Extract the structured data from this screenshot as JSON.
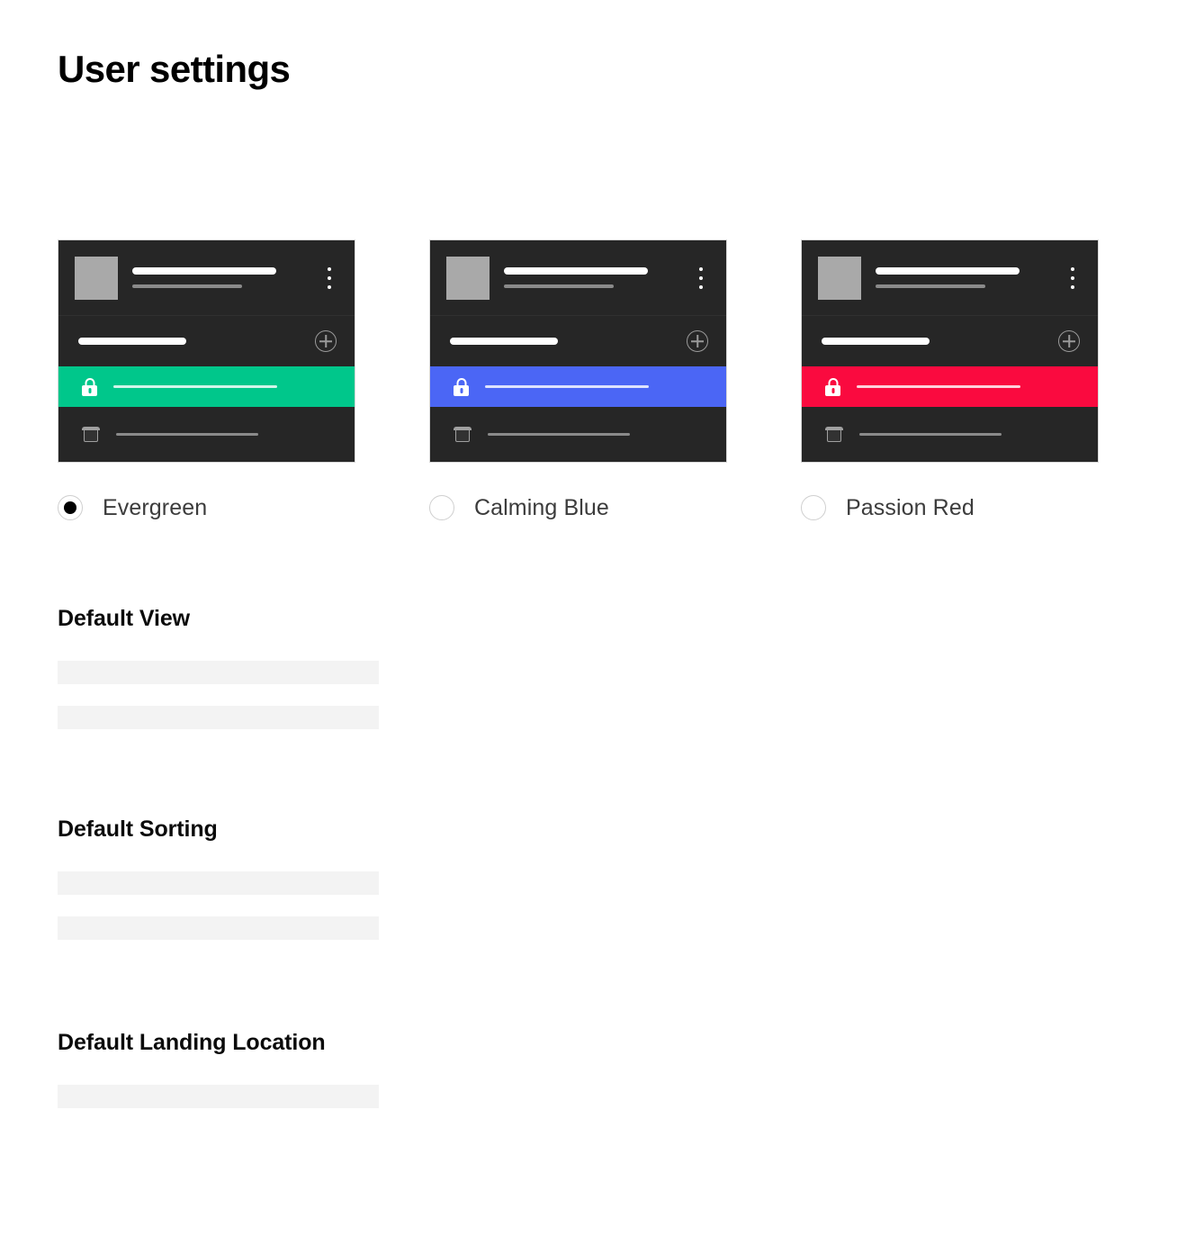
{
  "page": {
    "title": "User settings",
    "background": "#ffffff"
  },
  "theme_picker": {
    "name": "theme-selection",
    "selected": "Evergreen",
    "options": [
      {
        "id": "evergreen",
        "label": "Evergreen",
        "accent_color": "#00C78B",
        "card_background": "#262626",
        "selected": true
      },
      {
        "id": "calming-blue",
        "label": "Calming Blue",
        "accent_color": "#4B66F5",
        "card_background": "#262626",
        "selected": false
      },
      {
        "id": "passion-red",
        "label": "Passion Red",
        "accent_color": "#FA0A3F",
        "card_background": "#262626",
        "selected": false
      }
    ],
    "preview_icons": {
      "menu": "kebab-menu-icon",
      "add": "plus-circle-icon",
      "locked": "lock-icon",
      "trash": "trash-icon",
      "thumbnail": "thumbnail-placeholder"
    }
  },
  "sections": [
    {
      "id": "default-view",
      "title": "Default View",
      "placeholder_rows": 2
    },
    {
      "id": "default-sorting",
      "title": "Default Sorting",
      "placeholder_rows": 2
    },
    {
      "id": "default-landing-location",
      "title": "Default Landing Location",
      "placeholder_rows": 1
    }
  ]
}
